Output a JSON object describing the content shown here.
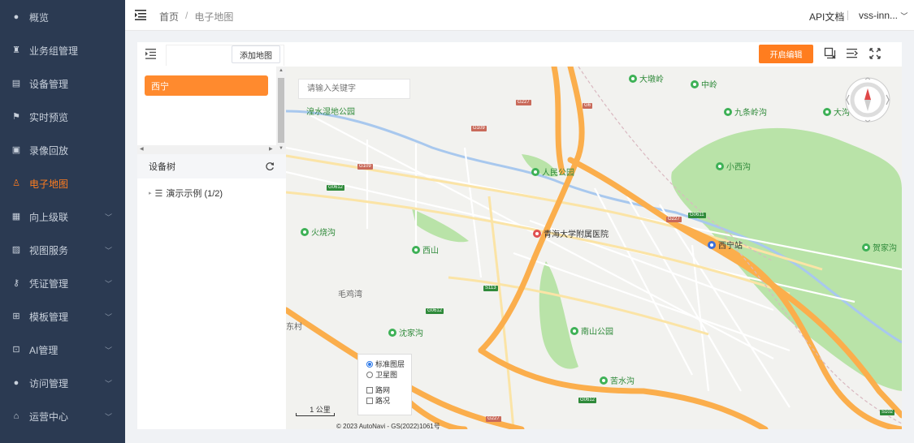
{
  "sidebar": {
    "items": [
      {
        "label": "概览",
        "icon": "dashboard-icon"
      },
      {
        "label": "业务组管理",
        "icon": "org-icon"
      },
      {
        "label": "设备管理",
        "icon": "device-icon"
      },
      {
        "label": "实时预览",
        "icon": "flag-icon"
      },
      {
        "label": "录像回放",
        "icon": "video-icon"
      },
      {
        "label": "电子地图",
        "icon": "map-icon",
        "active": true
      },
      {
        "label": "向上级联",
        "icon": "cascade-icon",
        "expandable": true
      },
      {
        "label": "视图服务",
        "icon": "view-icon",
        "expandable": true
      },
      {
        "label": "凭证管理",
        "icon": "key-icon",
        "expandable": true
      },
      {
        "label": "模板管理",
        "icon": "template-icon",
        "expandable": true
      },
      {
        "label": "AI管理",
        "icon": "ai-icon",
        "expandable": true
      },
      {
        "label": "访问管理",
        "icon": "user-icon",
        "expandable": true
      },
      {
        "label": "运营中心",
        "icon": "home-icon",
        "expandable": true
      }
    ],
    "active_color": "#ff7d1f",
    "bg_color": "#2b3a52"
  },
  "header": {
    "breadcrumb": [
      "首页",
      "电子地图"
    ],
    "separator": "/",
    "api_doc": "API文档",
    "user": "vss-inn..."
  },
  "toolbar": {
    "add_map_label": "添加地图",
    "edit_label": "开启编辑",
    "accent": "#ff7d1f"
  },
  "left_panel": {
    "maps": [
      "西宁"
    ],
    "device_tree_label": "设备树",
    "tree_root": "演示示例 (1/2)"
  },
  "map": {
    "search_placeholder": "请输入关键字",
    "pois": {
      "dadunling": "大墩岭",
      "zhongling": "中岭",
      "jiutiaolinggou": "九条岭沟",
      "dagou": "大沟",
      "shidi": "湟水湿地公园",
      "renmin": "人民公园",
      "xiaoxigou": "小西沟",
      "huoshaogou": "火烧沟",
      "xishan": "西山",
      "hospital": "青海大学附属医院",
      "station": "西宁站",
      "jiajiagou": "贺家沟",
      "maojiwan": "毛鸡湾",
      "dongcun": "东村",
      "shenjiagou": "沈家沟",
      "nanshan": "南山公园",
      "kushuigou": "苦水沟"
    },
    "road_badges": [
      "G227",
      "G109",
      "G0612",
      "G6",
      "S113",
      "G0611",
      "S102"
    ],
    "layers": {
      "standard": "标准图层",
      "satellite": "卫星图",
      "roadnet": "路网",
      "traffic": "路况"
    },
    "scale": "1 公里",
    "copyright": "© 2023 AutoNavi - GS(2022)1061号"
  }
}
